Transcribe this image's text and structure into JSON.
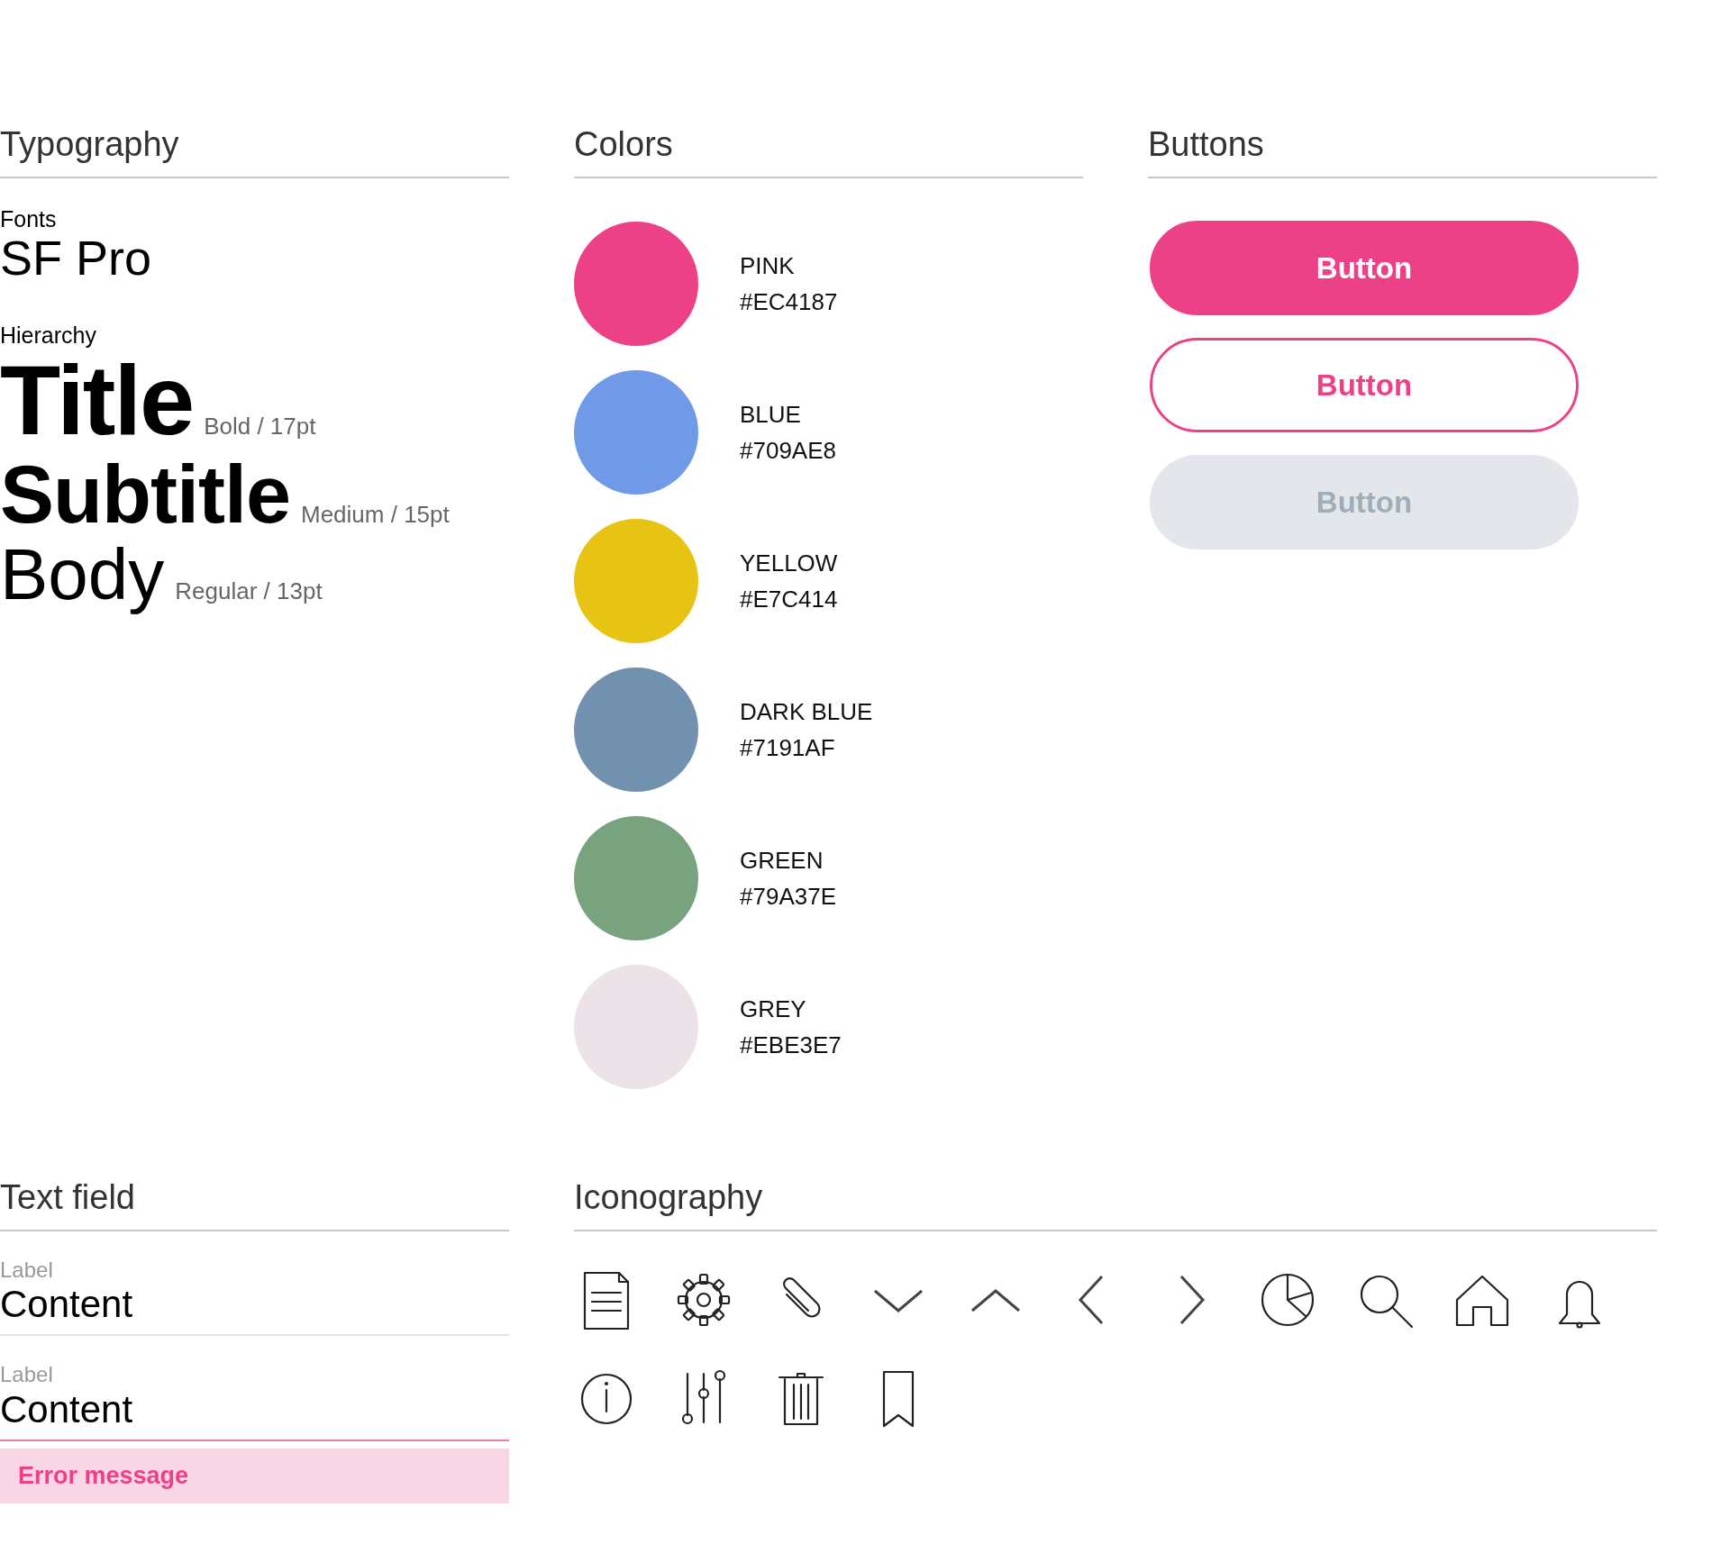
{
  "typography": {
    "heading": "Typography",
    "fonts_label": "Fonts",
    "font_name": "SF Pro",
    "hierarchy_label": "Hierarchy",
    "levels": [
      {
        "kind": "title",
        "sample": "Title",
        "spec": "Bold / 17pt"
      },
      {
        "kind": "subtitle",
        "sample": "Subtitle",
        "spec": "Medium / 15pt"
      },
      {
        "kind": "body",
        "sample": "Body",
        "spec": "Regular / 13pt"
      }
    ]
  },
  "colors": {
    "heading": "Colors",
    "swatches": [
      {
        "name": "PINK",
        "hex": "#EC4187",
        "color": "#ec4187"
      },
      {
        "name": "BLUE",
        "hex": "#709AE8",
        "color": "#709ae8"
      },
      {
        "name": "YELLOW",
        "hex": "#E7C414",
        "color": "#e7c414"
      },
      {
        "name": "DARK BLUE",
        "hex": "#7191AF",
        "color": "#7191af"
      },
      {
        "name": "GREEN",
        "hex": "#79A37E",
        "color": "#79a37e"
      },
      {
        "name": "GREY",
        "hex": "#EBE3E7",
        "color": "#ebe3e7"
      }
    ]
  },
  "buttons": {
    "heading": "Buttons",
    "items": [
      {
        "kind": "filled",
        "label": "Button",
        "disabled": false
      },
      {
        "kind": "outline",
        "label": "Button",
        "disabled": false
      },
      {
        "kind": "filled",
        "label": "Button",
        "disabled": true
      }
    ]
  },
  "text_field": {
    "heading": "Text field",
    "fields": [
      {
        "label": "Label",
        "value": "Content",
        "error": false
      },
      {
        "label": "Label",
        "value": "Content",
        "error": true,
        "error_message": "Error message"
      }
    ]
  },
  "iconography": {
    "heading": "Iconography"
  }
}
